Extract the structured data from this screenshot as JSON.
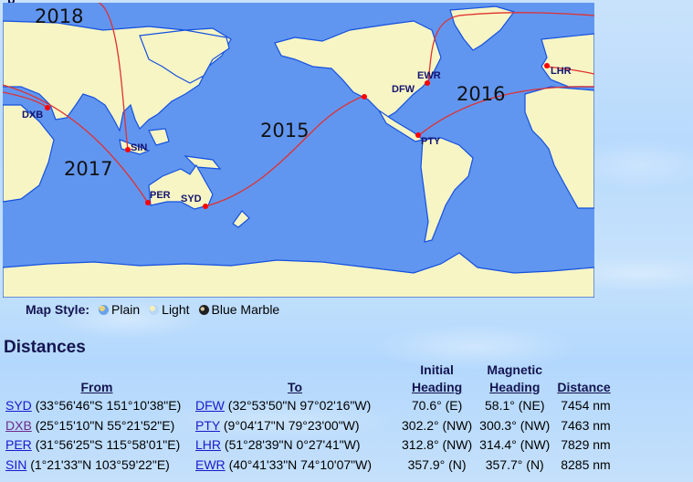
{
  "map": {
    "years": [
      "2018",
      "2017",
      "2016",
      "2015"
    ],
    "airports": [
      {
        "code": "DXB"
      },
      {
        "code": "SIN"
      },
      {
        "code": "PER"
      },
      {
        "code": "SYD"
      },
      {
        "code": "DFW"
      },
      {
        "code": "EWR"
      },
      {
        "code": "PTY"
      },
      {
        "code": "LHR"
      }
    ],
    "colors": {
      "ocean": "#6196f0",
      "land": "#f7f5c4",
      "route": "#e03030",
      "marker": "#ff0000",
      "label": "#141470"
    }
  },
  "map_style": {
    "label": "Map Style:",
    "options": [
      {
        "label": "Plain",
        "icon": "globe-plain-icon"
      },
      {
        "label": "Light",
        "icon": "globe-light-icon"
      },
      {
        "label": "Blue Marble",
        "icon": "globe-blue-marble-icon"
      }
    ]
  },
  "distances": {
    "title": "Distances",
    "headers": {
      "from": "From",
      "to": "To",
      "initial_top": "Initial",
      "initial_bottom": "Heading",
      "magnetic_top": "Magnetic",
      "magnetic_bottom": "Heading",
      "distance": "Distance"
    },
    "rows": [
      {
        "from_code": "SYD",
        "from_coords": "(33°56'46\"S 151°10'38\"E)",
        "to_code": "DFW",
        "to_coords": "(32°53'50\"N 97°02'16\"W)",
        "initial": "70.6° (E)",
        "magnetic": "58.1° (NE)",
        "distance": "7454 nm"
      },
      {
        "from_code": "DXB",
        "from_coords": "(25°15'10\"N 55°21'52\"E)",
        "to_code": "PTY",
        "to_coords": "(9°04'17\"N 79°23'00\"W)",
        "initial": "302.2° (NW)",
        "magnetic": "300.3° (NW)",
        "distance": "7463 nm"
      },
      {
        "from_code": "PER",
        "from_coords": "(31°56'25\"S 115°58'01\"E)",
        "to_code": "LHR",
        "to_coords": "(51°28'39\"N 0°27'41\"W)",
        "initial": "312.8° (NW)",
        "magnetic": "314.4° (NW)",
        "distance": "7829 nm"
      },
      {
        "from_code": "SIN",
        "from_coords": "(1°21'33\"N 103°59'22\"E)",
        "to_code": "EWR",
        "to_coords": "(40°41'33\"N 74°10'07\"W)",
        "initial": "357.9° (N)",
        "magnetic": "357.7° (N)",
        "distance": "8285 nm"
      }
    ]
  }
}
